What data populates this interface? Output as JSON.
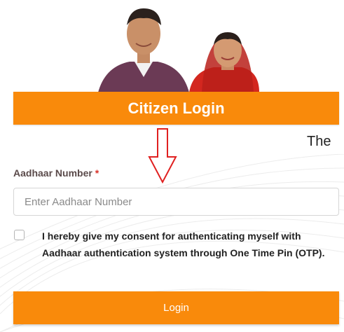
{
  "header": {
    "title": "Citizen Login"
  },
  "ticker": {
    "text": "The"
  },
  "aadhaar": {
    "label": "Aadhaar Number",
    "required_mark": "*",
    "placeholder": "Enter Aadhaar Number",
    "value": ""
  },
  "consent": {
    "checked": false,
    "text": "I hereby give my consent for authenticating myself with Aadhaar authentication system through One Time Pin (OTP)."
  },
  "login": {
    "label": "Login"
  },
  "colors": {
    "accent": "#f98a0b",
    "required": "#d9342b",
    "arrow": "#e02020"
  }
}
